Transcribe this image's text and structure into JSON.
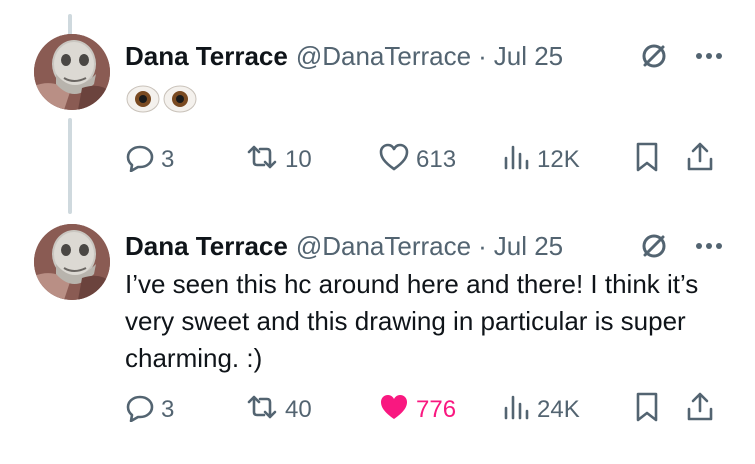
{
  "tweets": [
    {
      "author_name": "Dana Terrace",
      "author_handle": "@DanaTerrace",
      "separator": "·",
      "date": "Jul 25",
      "text": "",
      "emoji": [
        "eyes-emoji-left",
        "eyes-emoji-right"
      ],
      "replies": "3",
      "retweets": "10",
      "likes": "613",
      "liked": false,
      "views": "12K"
    },
    {
      "author_name": "Dana Terrace",
      "author_handle": "@DanaTerrace",
      "separator": "·",
      "date": "Jul 25",
      "text": "I’ve seen this hc around here and there! I think it’s very sweet and this drawing in particular is super charming. :)",
      "replies": "3",
      "retweets": "40",
      "likes": "776",
      "liked": true,
      "views": "24K"
    }
  ],
  "colors": {
    "text_primary": "#0f1419",
    "text_secondary": "#536471",
    "like_active": "#f91880",
    "thread_line": "#cfd9de"
  },
  "icons": {
    "reply": "reply-icon",
    "retweet": "retweet-icon",
    "like": "heart-icon",
    "views": "views-bar-chart-icon",
    "bookmark": "bookmark-icon",
    "share": "share-icon",
    "blocked": "no-entry-icon",
    "more": "more-icon"
  }
}
